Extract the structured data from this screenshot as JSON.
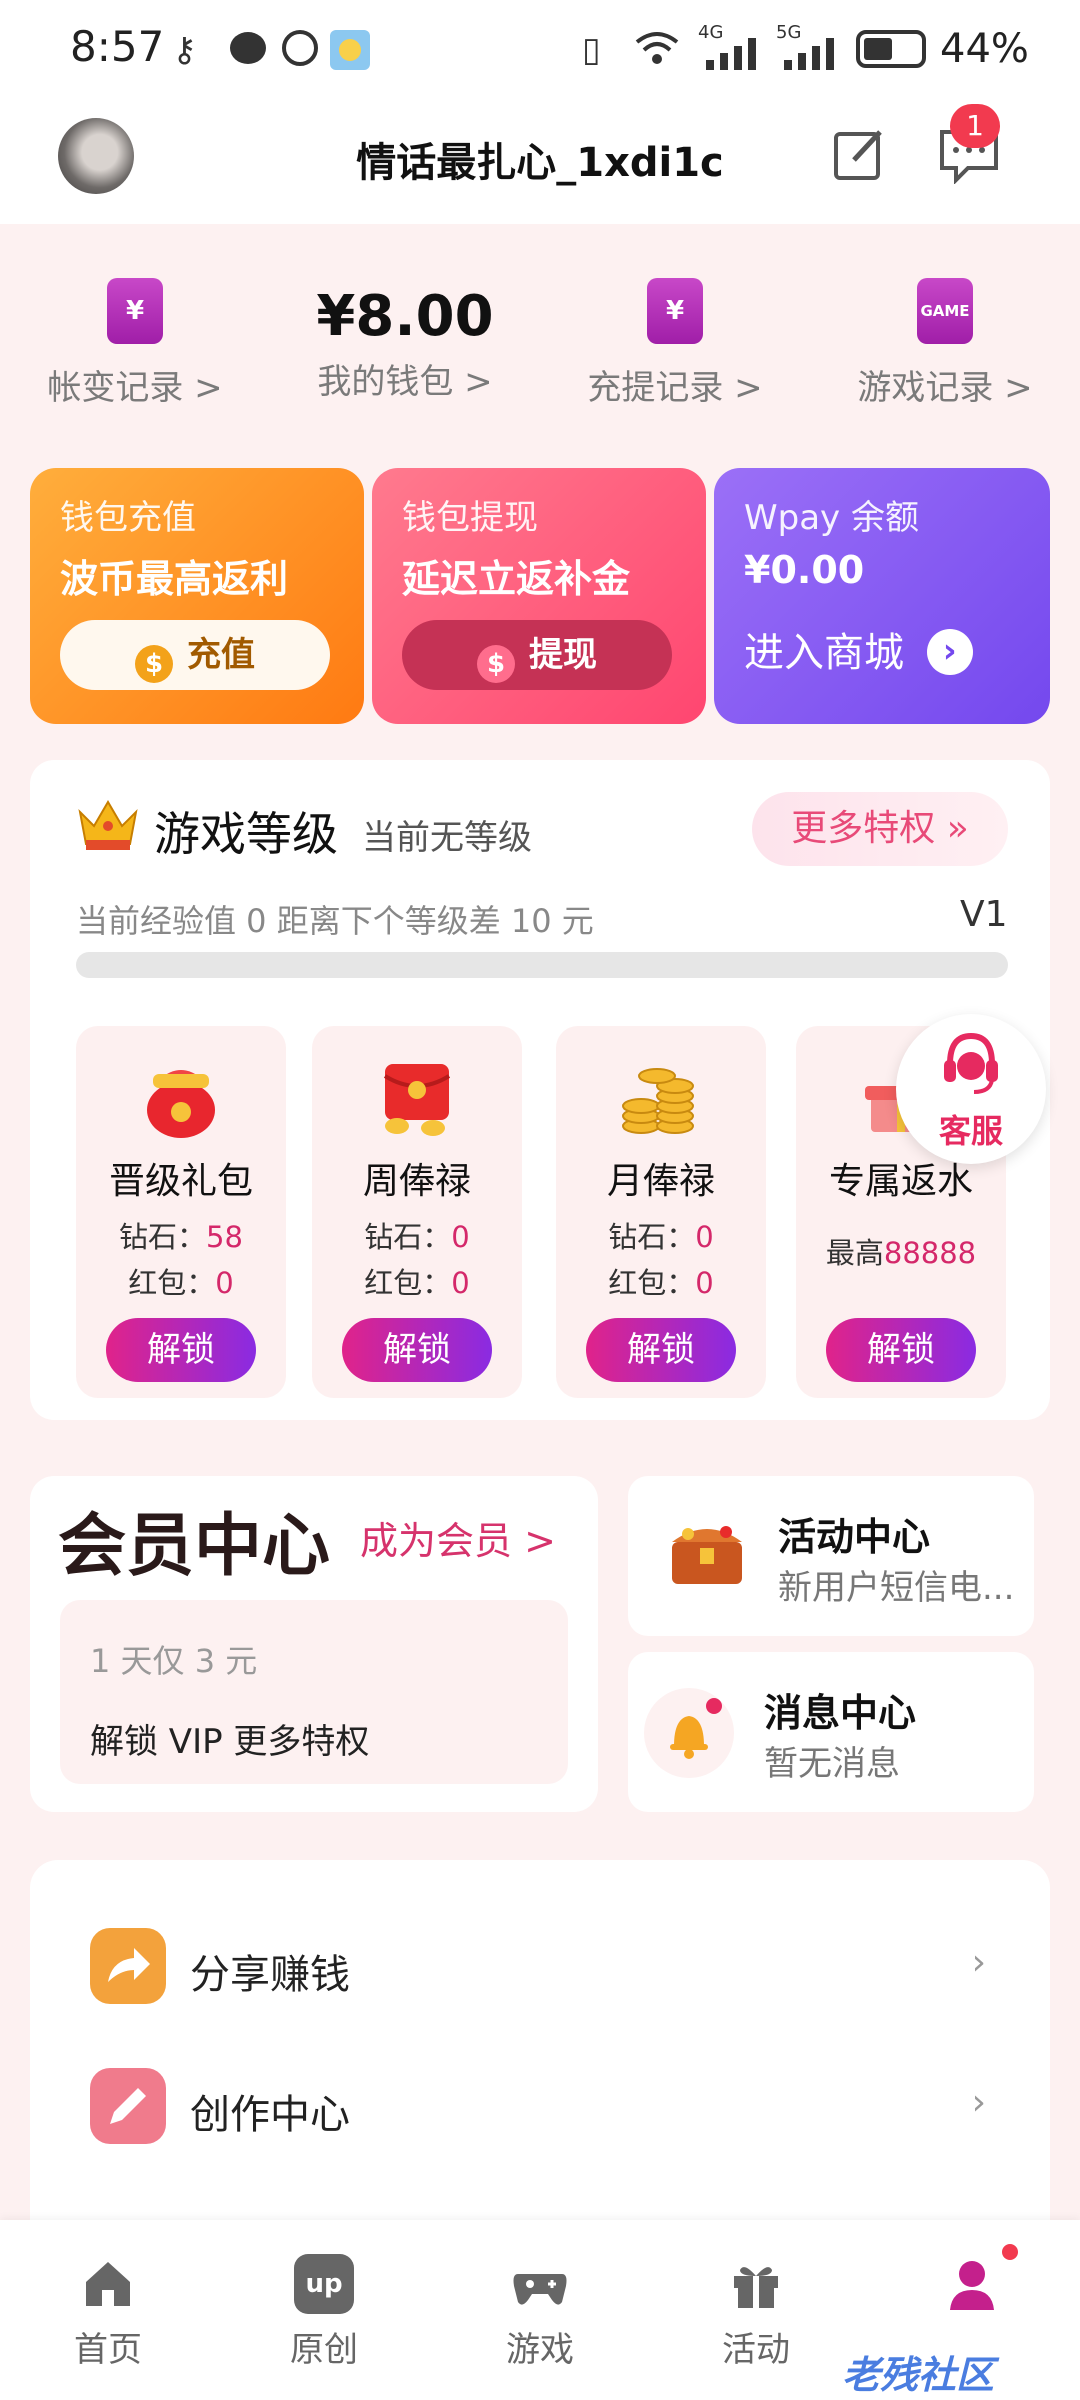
{
  "status_bar": {
    "time": "8:57",
    "network_a": "4G",
    "network_b": "5G",
    "battery": "44%"
  },
  "header": {
    "username": "情话最扎心_1xdi1c",
    "message_badge": "1"
  },
  "wallet": {
    "items": [
      {
        "label": "帐变记录 >",
        "icon": "wallet-yen-icon",
        "glyph": "¥"
      },
      {
        "label": "我的钱包 >",
        "amount": "¥8.00"
      },
      {
        "label": "充提记录 >",
        "icon": "wallet-yen-icon",
        "glyph": "¥"
      },
      {
        "label": "游戏记录 >",
        "icon": "game-phone-icon",
        "glyph": "GAME"
      }
    ]
  },
  "promos": [
    {
      "title": "钱包充值",
      "subtitle": "波币最高返利",
      "button": "充值",
      "coin": "$"
    },
    {
      "title": "钱包提现",
      "subtitle": "延迟立返补金",
      "button": "提现",
      "coin": "$"
    },
    {
      "title": "Wpay 余额",
      "subtitle": "¥0.00",
      "button": "进入商城"
    }
  ],
  "level": {
    "title": "游戏等级",
    "status": "当前无等级",
    "more": "更多特权 »",
    "exp_text": "当前经验值 0 距离下个等级差 10 元",
    "next_level": "V1",
    "progress": 0,
    "perks": [
      {
        "name": "晋级礼包",
        "line1_label": "钻石：",
        "line1_value": "58",
        "line2_label": "红包：",
        "line2_value": "0",
        "button": "解锁"
      },
      {
        "name": "周俸禄",
        "line1_label": "钻石：",
        "line1_value": "0",
        "line2_label": "红包：",
        "line2_value": "0",
        "button": "解锁"
      },
      {
        "name": "月俸禄",
        "line1_label": "钻石：",
        "line1_value": "0",
        "line2_label": "红包：",
        "line2_value": "0",
        "button": "解锁"
      },
      {
        "name": "专属返水",
        "line1_label": "最高",
        "line1_value": "88888",
        "button": "解锁"
      }
    ],
    "customer_service": "客服"
  },
  "member": {
    "title": "会员中心",
    "cta": "成为会员 >",
    "price": "1 天仅 3 元",
    "desc": "解锁 VIP 更多特权"
  },
  "activity": {
    "title": "活动中心",
    "subtitle": "新用户短信电..."
  },
  "messages": {
    "title": "消息中心",
    "subtitle": "暂无消息"
  },
  "list": [
    {
      "label": "分享赚钱",
      "chevron": "›"
    },
    {
      "label": "创作中心",
      "chevron": "›"
    }
  ],
  "nav": [
    {
      "label": "首页"
    },
    {
      "label": "原创",
      "icon_text": "up"
    },
    {
      "label": "游戏"
    },
    {
      "label": "活动"
    },
    {
      "label": ""
    }
  ],
  "watermark": "老残社区",
  "colors": {
    "page_bg": "#fdf1f1",
    "accent_pink": "#d6336c",
    "unlock_gradient_start": "#e0238a",
    "unlock_gradient_end": "#8a2be2",
    "recharge_card": "#ff8a1f",
    "withdraw_card": "#ff5c7c",
    "wpay_card": "#8f5cf5"
  }
}
